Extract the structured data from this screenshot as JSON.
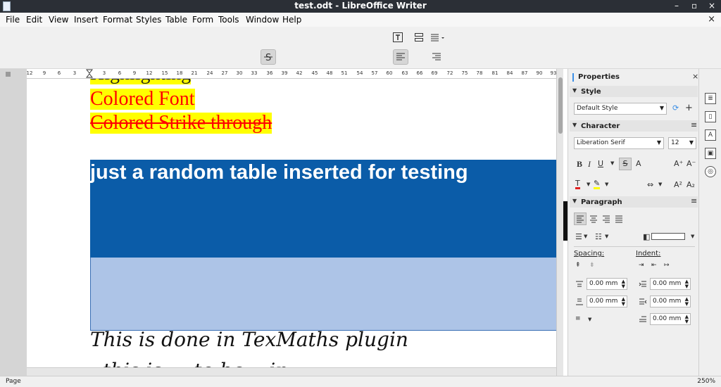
{
  "window": {
    "title": "test.odt - LibreOffice Writer",
    "minimize": "–",
    "restore": "▫",
    "close": "×"
  },
  "menu": [
    "File",
    "Edit",
    "View",
    "Insert",
    "Format",
    "Styles",
    "Table",
    "Form",
    "Tools",
    "Window",
    "Help"
  ],
  "menu_close_doc": "×",
  "ruler": {
    "ticks": [
      "12",
      "9",
      "6",
      "3",
      "3",
      "6",
      "9",
      "12",
      "15",
      "18",
      "21",
      "24",
      "27",
      "30",
      "33",
      "36",
      "39",
      "42",
      "45",
      "48",
      "51",
      "54",
      "57",
      "60",
      "63",
      "66",
      "69",
      "72",
      "75",
      "78",
      "81",
      "84",
      "87",
      "90",
      "93"
    ]
  },
  "document": {
    "partial_line": "Highlighting",
    "colored_font": "Colored Font",
    "colored_strike": "Colored Strike through",
    "table_heading": "just a random table inserted for testing",
    "math_line": "This is done in TexMaths plugin",
    "partial_bottom": "..this is ... to be ...in"
  },
  "sidebar": {
    "title": "Properties",
    "close": "×",
    "style_header": "Style",
    "style_value": "Default Style",
    "character_header": "Character",
    "font_name": "Liberation Serif",
    "font_size": "12",
    "paragraph_header": "Paragraph",
    "spacing_label": "Spacing:",
    "indent_label": "Indent:",
    "above_spacing": "0.00 mm",
    "below_spacing": "0.00 mm",
    "before_indent": "0.00 mm",
    "after_indent": "0.00 mm",
    "first_indent": "0.00 mm"
  },
  "statusbar": {
    "page": "Page",
    "zoom": "250%"
  },
  "colors": {
    "titlebar": "#2b2f36",
    "table_head": "#0b5ca8",
    "table_body": "#adc4e7",
    "highlight": "#ffff00",
    "font_red": "#ff0000"
  }
}
